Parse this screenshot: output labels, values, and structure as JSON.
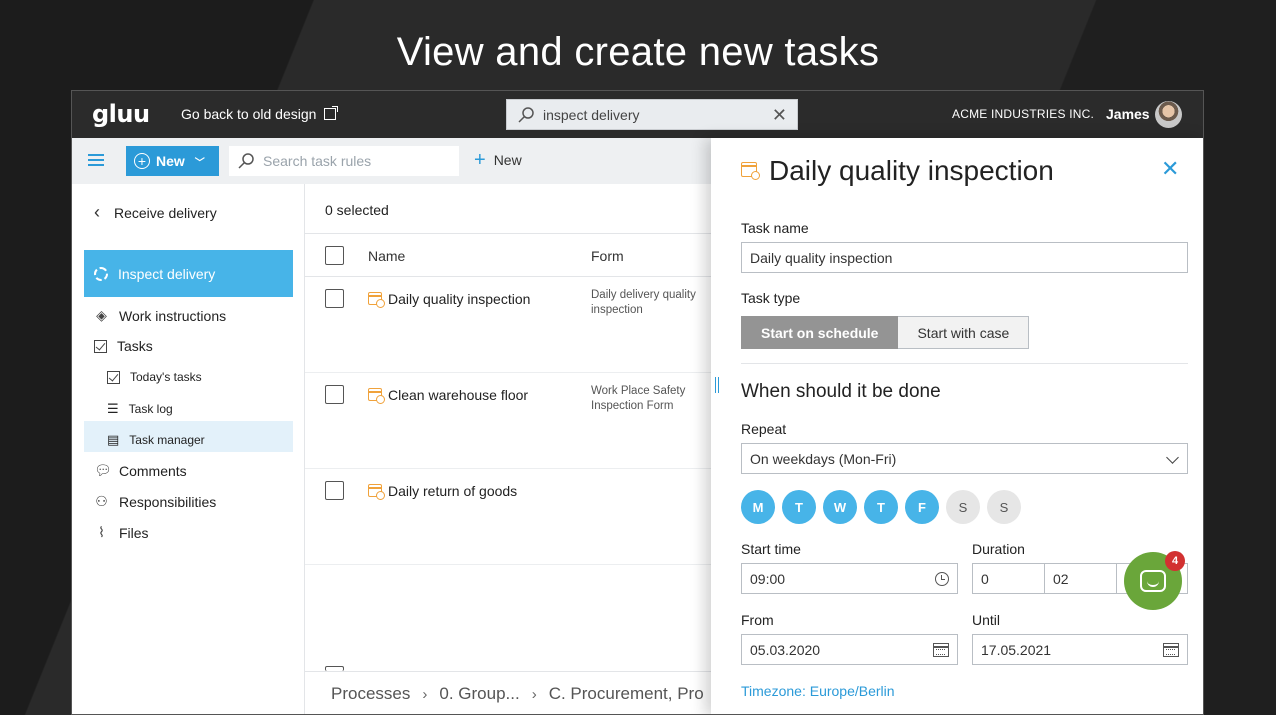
{
  "headline": "View and create new tasks",
  "topbar": {
    "logo": "gluu",
    "old_design_link": "Go back to old design",
    "search_value": "inspect delivery",
    "company": "ACME INDUSTRIES INC.",
    "user": "James"
  },
  "toolbar": {
    "new_label": "New",
    "search_placeholder": "Search task rules",
    "new_text": "New"
  },
  "sidebar": {
    "back_label": "Receive delivery",
    "active_item": "Inspect delivery",
    "items": [
      {
        "label": "Work instructions",
        "icon": "diamond-icon"
      },
      {
        "label": "Tasks",
        "icon": "checkbox-icon"
      }
    ],
    "subitems": [
      {
        "label": "Today's tasks",
        "icon": "checkbox-icon"
      },
      {
        "label": "Task log",
        "icon": "list-icon"
      },
      {
        "label": "Task manager",
        "icon": "form-icon"
      }
    ],
    "bottom_items": [
      {
        "label": "Comments",
        "icon": "comment-icon"
      },
      {
        "label": "Responsibilities",
        "icon": "person-icon"
      },
      {
        "label": "Files",
        "icon": "paperclip-icon"
      }
    ]
  },
  "list": {
    "selected_count": "0 selected",
    "columns": [
      "Name",
      "Form"
    ],
    "rows": [
      {
        "name": "Daily quality inspection",
        "form": "Daily delivery quality inspection"
      },
      {
        "name": "Clean warehouse floor",
        "form": "Work Place Safety Inspection Form"
      },
      {
        "name": "Daily return of goods",
        "form": ""
      }
    ],
    "breadcrumb": [
      "Processes",
      "0. Group...",
      "C. Procurement, Pro"
    ]
  },
  "panel": {
    "title": "Daily quality inspection",
    "task_name_label": "Task name",
    "task_name_value": "Daily quality inspection",
    "task_type_label": "Task type",
    "task_type_options": [
      "Start on schedule",
      "Start with case"
    ],
    "section_title": "When should it be done",
    "repeat_label": "Repeat",
    "repeat_value": "On weekdays (Mon-Fri)",
    "days": [
      {
        "label": "M",
        "on": true
      },
      {
        "label": "T",
        "on": true
      },
      {
        "label": "W",
        "on": true
      },
      {
        "label": "T",
        "on": true
      },
      {
        "label": "F",
        "on": true
      },
      {
        "label": "S",
        "on": false
      },
      {
        "label": "S",
        "on": false
      }
    ],
    "start_time_label": "Start time",
    "start_time_value": "09:00",
    "duration_label": "Duration",
    "duration_days": "0",
    "duration_hours": "02",
    "from_label": "From",
    "from_value": "05.03.2020",
    "until_label": "Until",
    "until_value": "17.05.2021",
    "timezone": "Timezone: Europe/Berlin"
  },
  "chat": {
    "badge_count": "4"
  },
  "colors": {
    "accent": "#2b9ad8",
    "active_bg": "#47b4e8",
    "chat": "#6aa63a",
    "task_icon": "#f0a23b"
  }
}
